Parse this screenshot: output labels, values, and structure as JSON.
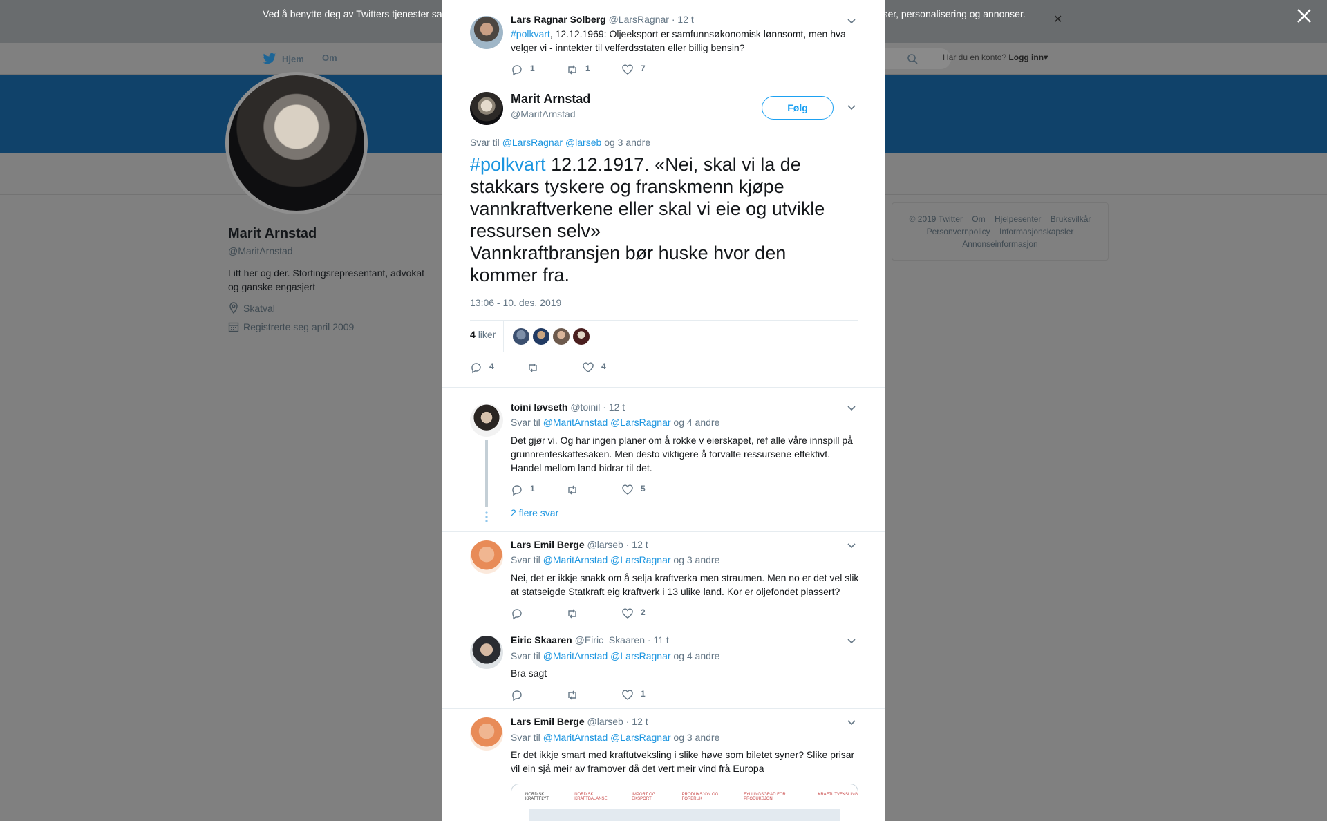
{
  "cookie_bar": {
    "text": "Ved å benytte deg av Twitters tjenester samtykker du til bruk av informasjonskapsler. Twitter og partnere bruker informasjonskapsler til bl.a. analyser, personalisering og annonser."
  },
  "topnav": {
    "home": "Hjem",
    "about": "Om",
    "account_question": "Har du en konto?",
    "login": "Logg inn"
  },
  "profile": {
    "name": "Marit Arnstad",
    "handle": "@MaritArnstad",
    "bio": "Litt her og der. Stortingsrepresentant, advokat og ganske engasjert",
    "location": "Skatval",
    "joined": "Registrerte seg april 2009"
  },
  "footer": {
    "links": [
      "© 2019 Twitter",
      "Om",
      "Hjelpesenter",
      "Bruksvilkår",
      "Personvernpolicy",
      "Informasjonskapsler",
      "Annonseinformasjon"
    ]
  },
  "parent_tweet": {
    "name": "Lars Ragnar Solberg",
    "handle": "@LarsRagnar",
    "time": "· 12 t",
    "hashtag": "#polkvart",
    "text": ", 12.12.1969: Oljeeksport er samfunnsøkonomisk lønnsomt, men hva velger vi - inntekter til velferdsstaten eller billig bensin?",
    "replies": "1",
    "retweets": "1",
    "likes": "7"
  },
  "main_tweet": {
    "name": "Marit Arnstad",
    "handle": "@MaritArnstad",
    "follow": "Følg",
    "reply_prefix": "Svar til",
    "reply_to_1": "@LarsRagnar",
    "reply_to_2": "@larseb",
    "reply_suffix": "og 3 andre",
    "hashtag": "#polkvart",
    "text": " 12.12.1917. «Nei, skal vi la de stakkars tyskere og franskmenn kjøpe vannkraftverkene eller skal vi eie og utvikle ressursen selv»\nVannkraftbransjen bør huske hvor den kommer fra.",
    "timestamp": "13:06 - 10. des. 2019",
    "like_count": "4",
    "like_label": "liker",
    "replies": "4",
    "likes": "4"
  },
  "replies": [
    {
      "name": "toini løvseth",
      "handle": "@toinil",
      "time": "· 12 t",
      "reply_prefix": "Svar til",
      "reply_to_1": "@MaritArnstad",
      "reply_to_2": "@LarsRagnar",
      "reply_suffix": "og 4 andre",
      "text": "Det gjør vi. Og har ingen planer om å rokke v eierskapet, ref alle våre innspill på grunnrenteskattesaken. Men desto viktigere å forvalte ressursene effektivt. Handel mellom land bidrar til det.",
      "replies": "1",
      "likes": "5"
    },
    {
      "name": "Lars Emil Berge",
      "handle": "@larseb",
      "time": "· 12 t",
      "reply_prefix": "Svar til",
      "reply_to_1": "@MaritArnstad",
      "reply_to_2": "@LarsRagnar",
      "reply_suffix": "og 3 andre",
      "text": "Nei, det er ikkje snakk om å selja kraftverka men straumen. Men no er det vel slik at statseigde Statkraft eig kraftverk i 13 ulike land. Kor er oljefondet plassert?",
      "likes": "2"
    },
    {
      "name": "Eiric Skaaren",
      "handle": "@Eiric_Skaaren",
      "time": "· 11 t",
      "reply_prefix": "Svar til",
      "reply_to_1": "@MaritArnstad",
      "reply_to_2": "@LarsRagnar",
      "reply_suffix": "og 4 andre",
      "text": "Bra sagt",
      "likes": "1"
    },
    {
      "name": "Lars Emil Berge",
      "handle": "@larseb",
      "time": "· 12 t",
      "reply_prefix": "Svar til",
      "reply_to_1": "@MaritArnstad",
      "reply_to_2": "@LarsRagnar",
      "reply_suffix": "og 3 andre",
      "text": "Er det ikkje smart med kraftutveksling i slike høve som biletet syner? Slike prisar vil ein sjå meir av framover då det vert meir vind frå Europa"
    }
  ],
  "more_replies": "2 flere svar",
  "embed_tabs": [
    "NORDISK KRAFTFLYT",
    "NORDISK KRAFTBALANSE",
    "IMPORT OG EKSPORT",
    "PRODUKSJON OG FORBRUK",
    "FYLLINGSGRAD FOR PRODUKSJON",
    "KRAFTUTVEKSLING"
  ],
  "colors": {
    "link": "#1b95e0",
    "follow": "#1da1f2",
    "banner": "#10426a"
  }
}
